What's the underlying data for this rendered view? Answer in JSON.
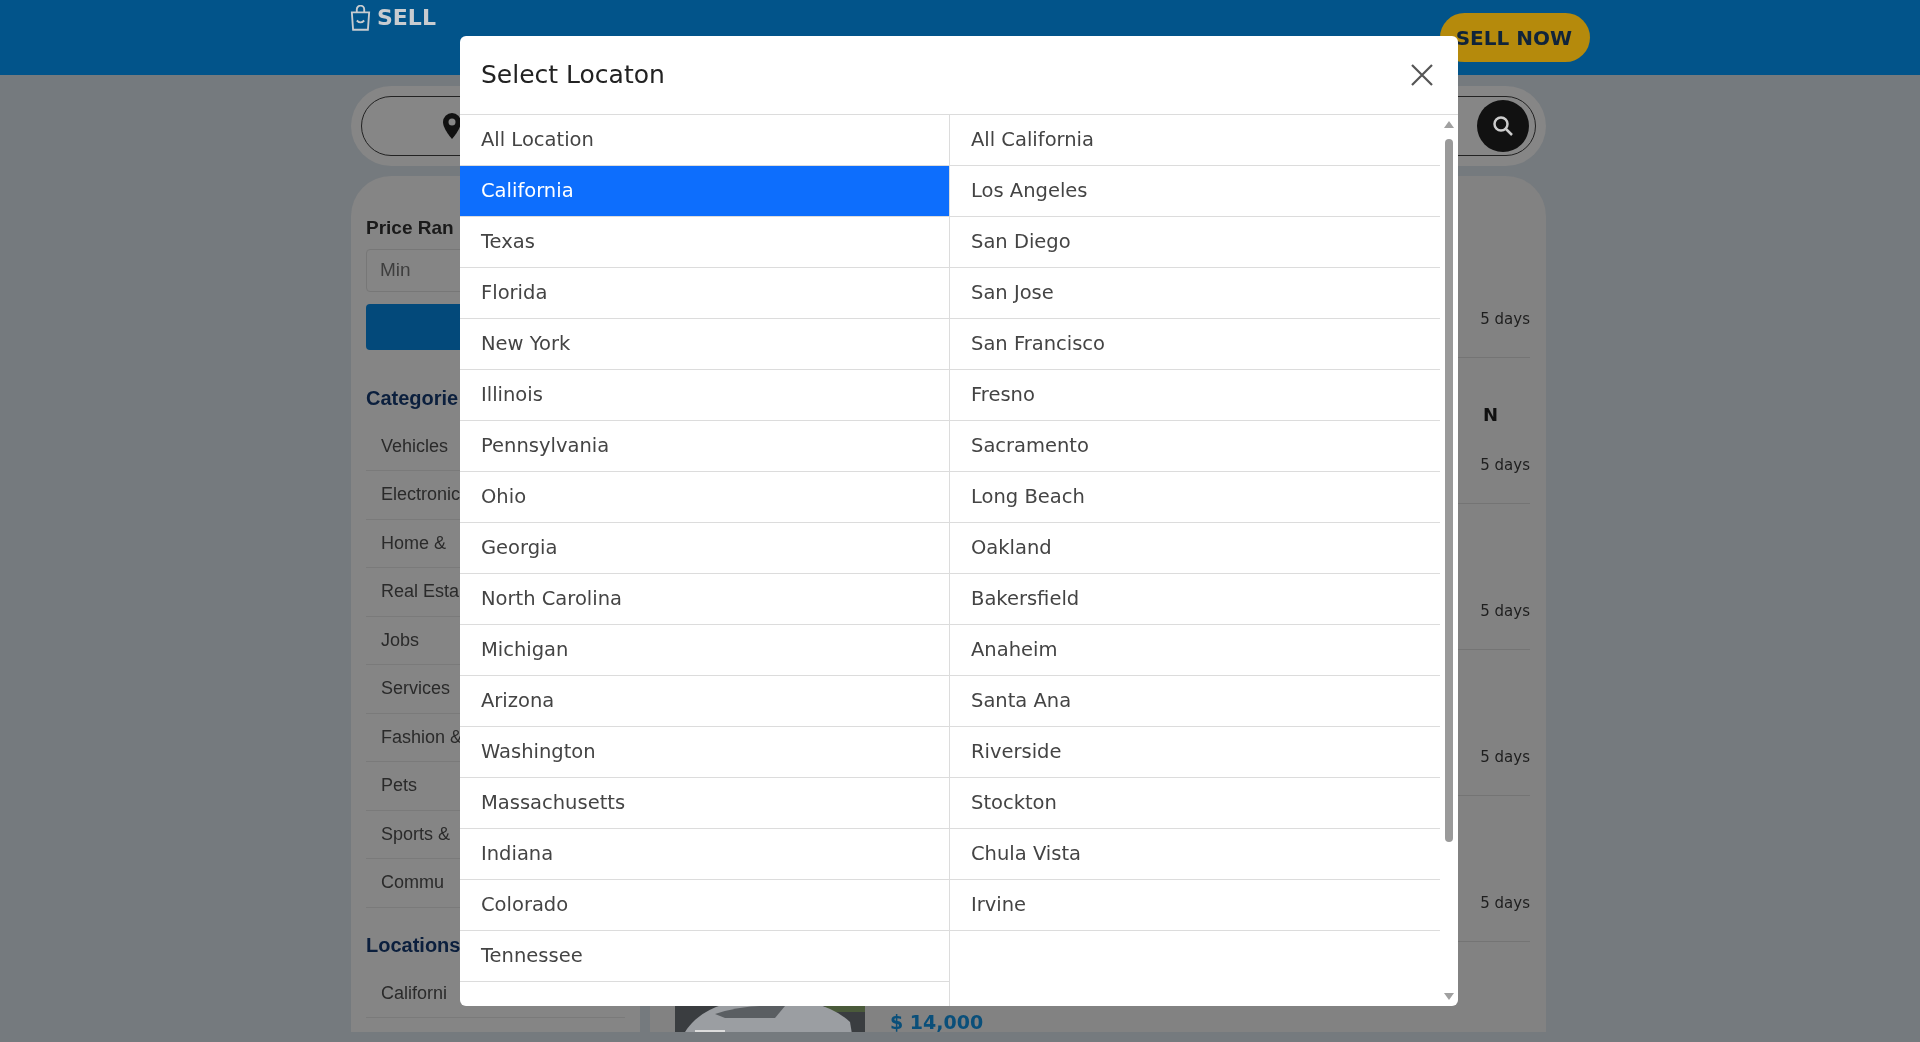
{
  "header": {
    "logo": "SELL",
    "sell_button": "SELL NOW"
  },
  "sidebar": {
    "price_label": "Price Ran",
    "min_placeholder": "Min",
    "categories_heading": "Categorie",
    "categories": [
      "Vehicles",
      "Electronic",
      "Home &",
      "Real Esta",
      "Jobs",
      "Services",
      "Fashion &",
      "Pets",
      "Sports &",
      "Commu"
    ],
    "locations_heading": "Locations",
    "locations": [
      "Californi"
    ]
  },
  "listings": [
    {
      "age": "5 days"
    },
    {
      "title": "N",
      "age": "5 days"
    },
    {
      "age": "5 days"
    },
    {
      "age": "5 days"
    },
    {
      "age": "5 days"
    }
  ],
  "last_listing": {
    "kind": "picture",
    "price": "$ 14,000"
  },
  "modal": {
    "title": "Select Locaton",
    "states": [
      {
        "label": "All Location",
        "selected": false
      },
      {
        "label": "California",
        "selected": true
      },
      {
        "label": "Texas",
        "selected": false
      },
      {
        "label": "Florida",
        "selected": false
      },
      {
        "label": "New York",
        "selected": false
      },
      {
        "label": "Illinois",
        "selected": false
      },
      {
        "label": "Pennsylvania",
        "selected": false
      },
      {
        "label": "Ohio",
        "selected": false
      },
      {
        "label": "Georgia",
        "selected": false
      },
      {
        "label": "North Carolina",
        "selected": false
      },
      {
        "label": "Michigan",
        "selected": false
      },
      {
        "label": "Arizona",
        "selected": false
      },
      {
        "label": "Washington",
        "selected": false
      },
      {
        "label": "Massachusetts",
        "selected": false
      },
      {
        "label": "Indiana",
        "selected": false
      },
      {
        "label": "Colorado",
        "selected": false
      },
      {
        "label": "Tennessee",
        "selected": false
      }
    ],
    "cities": [
      {
        "label": "All California",
        "selected": false
      },
      {
        "label": "Los Angeles",
        "selected": false
      },
      {
        "label": "San Diego",
        "selected": false
      },
      {
        "label": "San Jose",
        "selected": false
      },
      {
        "label": "San Francisco",
        "selected": false
      },
      {
        "label": "Fresno",
        "selected": false
      },
      {
        "label": "Sacramento",
        "selected": false
      },
      {
        "label": "Long Beach",
        "selected": false
      },
      {
        "label": "Oakland",
        "selected": false
      },
      {
        "label": "Bakersfield",
        "selected": false
      },
      {
        "label": "Anaheim",
        "selected": false
      },
      {
        "label": "Santa Ana",
        "selected": false
      },
      {
        "label": "Riverside",
        "selected": false
      },
      {
        "label": "Stockton",
        "selected": false
      },
      {
        "label": "Chula Vista",
        "selected": false
      },
      {
        "label": "Irvine",
        "selected": false
      }
    ]
  }
}
